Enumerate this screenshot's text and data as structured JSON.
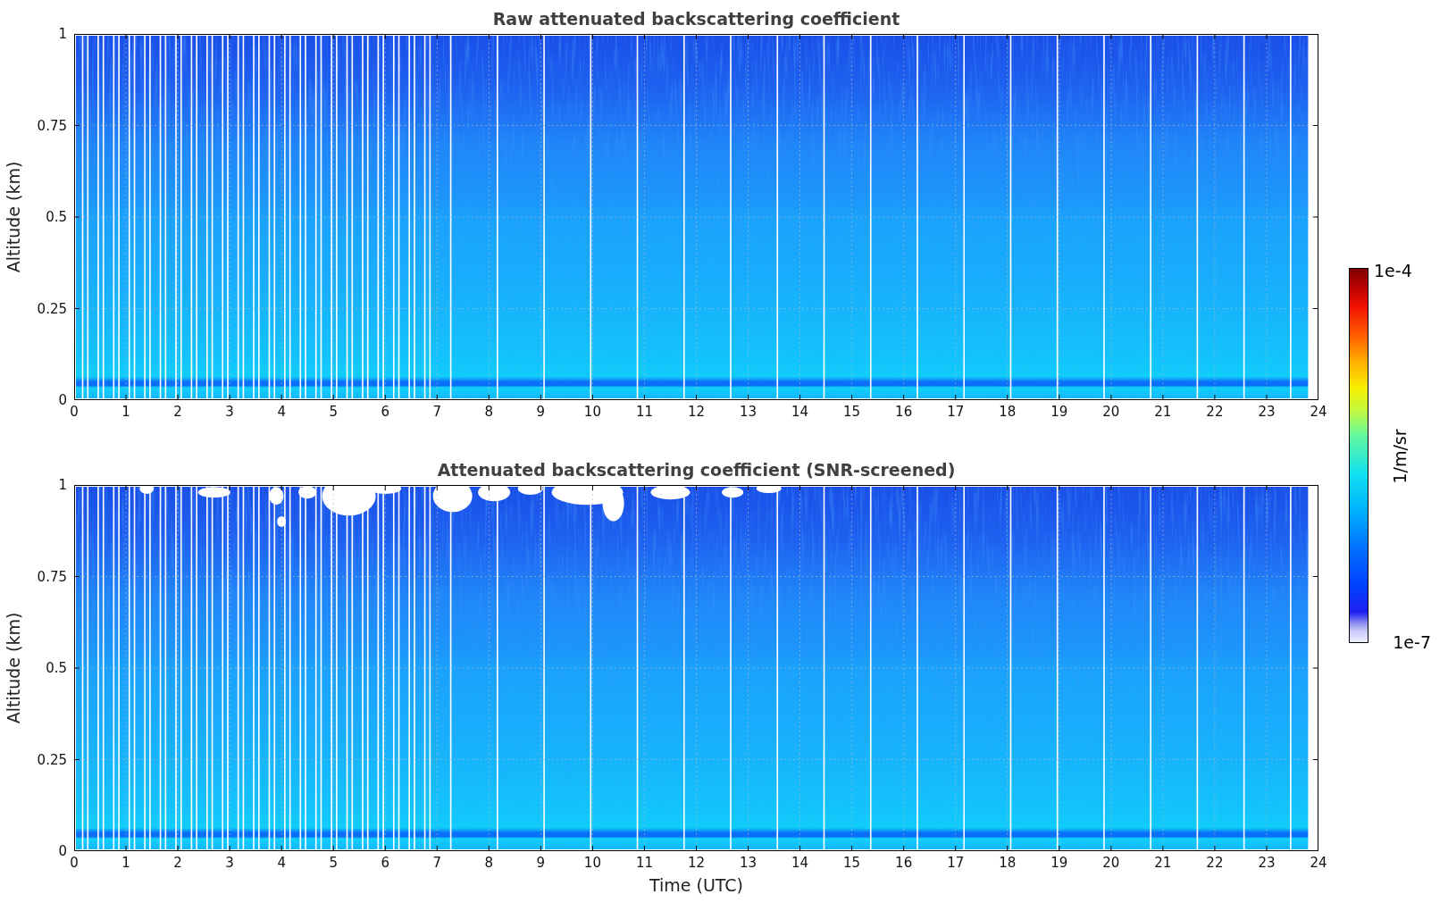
{
  "plots": [
    {
      "title": "Raw attenuated backscattering coefficient",
      "ylabel": "Altitude (km)",
      "yticks": [
        "1",
        "0.75",
        "0.5",
        "0.25",
        "0"
      ],
      "xticks": [
        "0",
        "1",
        "2",
        "3",
        "4",
        "5",
        "6",
        "7",
        "8",
        "9",
        "10",
        "11",
        "12",
        "13",
        "14",
        "15",
        "16",
        "17",
        "18",
        "19",
        "20",
        "21",
        "22",
        "23",
        "24"
      ],
      "screened": false
    },
    {
      "title": "Attenuated backscattering coefficient (SNR-screened)",
      "ylabel": "Altitude (km)",
      "yticks": [
        "1",
        "0.75",
        "0.5",
        "0.25",
        "0"
      ],
      "xticks": [
        "0",
        "1",
        "2",
        "3",
        "4",
        "5",
        "6",
        "7",
        "8",
        "9",
        "10",
        "11",
        "12",
        "13",
        "14",
        "15",
        "16",
        "17",
        "18",
        "19",
        "20",
        "21",
        "22",
        "23",
        "24"
      ],
      "screened": true
    }
  ],
  "xlabel": "Time (UTC)",
  "colorbar": {
    "label": "1/m/sr",
    "max_label": "1e-4",
    "min_label": "1e-7"
  }
}
